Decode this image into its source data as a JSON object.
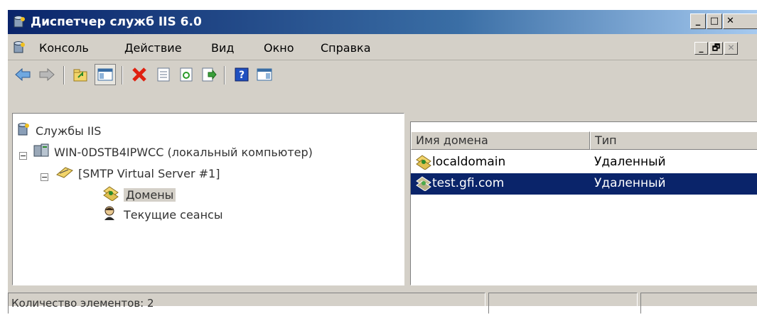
{
  "window": {
    "title": "Диспетчер служб IIS 6.0",
    "min_glyph": "_",
    "max_glyph": "□",
    "close_glyph": "✕"
  },
  "menubar": {
    "items": [
      "Консоль",
      "Действие",
      "Вид",
      "Окно",
      "Справка"
    ],
    "mdi_min_glyph": "_",
    "mdi_restore_glyph": "🗗",
    "mdi_close_glyph": "✕"
  },
  "toolbar": {
    "buttons": [
      "back-icon",
      "forward-icon",
      "up-folder-icon",
      "show-hide-tree-icon",
      "delete-icon",
      "properties-icon",
      "refresh-icon",
      "export-list-icon",
      "help-icon",
      "action-pane-icon"
    ]
  },
  "tree": {
    "root": "Службы IIS",
    "computer": "WIN-0DSTB4IPWCC (локальный компьютер)",
    "smtp": "[SMTP Virtual Server #1]",
    "domains": "Домены",
    "sessions": "Текущие сеансы",
    "expander_minus": "−"
  },
  "list": {
    "columns": [
      "Имя домена",
      "Тип"
    ],
    "rows": [
      {
        "name": "localdomain",
        "type": "Удаленный",
        "selected": false
      },
      {
        "name": "test.gfi.com",
        "type": "Удаленный",
        "selected": true
      }
    ]
  },
  "statusbar": {
    "text": "Количество элементов: 2"
  },
  "colors": {
    "selection": "#0a246a",
    "title_start": "#0a246a",
    "chrome": "#d4d0c8"
  }
}
